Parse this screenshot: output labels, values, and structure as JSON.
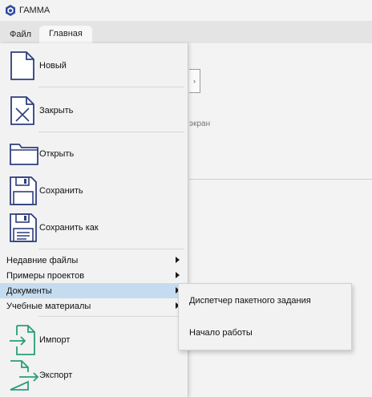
{
  "window": {
    "title": "ГАММА",
    "logo_color": "#2f4aa0"
  },
  "tabs": [
    {
      "label": "Файл"
    },
    {
      "label": "Главная"
    }
  ],
  "ribbon": {
    "label_fragment": "экран"
  },
  "file_menu": {
    "items": [
      {
        "label": "Новый",
        "icon": "new-file-icon"
      },
      {
        "label": "Закрыть",
        "icon": "close-file-icon"
      },
      {
        "label": "Открыть",
        "icon": "folder-icon"
      },
      {
        "label": "Сохранить",
        "icon": "save-icon"
      },
      {
        "label": "Сохранить как",
        "icon": "save-as-icon"
      }
    ],
    "submenus": [
      {
        "label": "Недавние файлы"
      },
      {
        "label": "Примеры проектов"
      },
      {
        "label": "Документы"
      },
      {
        "label": "Учебные материалы"
      }
    ],
    "bottom": [
      {
        "label": "Импорт",
        "icon": "import-icon"
      },
      {
        "label": "Экспорт",
        "icon": "export-icon"
      }
    ]
  },
  "documents_submenu": [
    {
      "label": "Диспетчер пакетного задания"
    },
    {
      "label": "Начало работы"
    }
  ],
  "colors": {
    "icon_blue": "#2f3f7f",
    "icon_green": "#2a9d7a",
    "active_highlight": "#c5dcf0"
  }
}
